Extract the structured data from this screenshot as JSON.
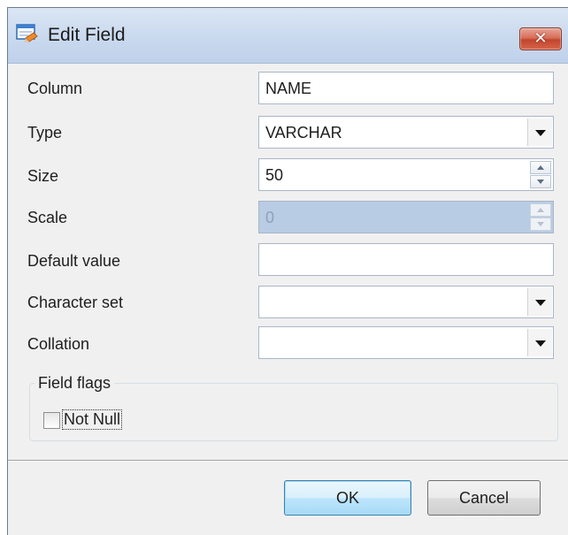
{
  "window": {
    "title": "Edit Field",
    "close_symbol": "✕"
  },
  "fields": [
    {
      "label": "Column",
      "value": "NAME",
      "kind": "text",
      "enabled": true
    },
    {
      "label": "Type",
      "value": "VARCHAR",
      "kind": "dropdown",
      "enabled": true
    },
    {
      "label": "Size",
      "value": "50",
      "kind": "spinner",
      "enabled": true
    },
    {
      "label": "Scale",
      "value": "0",
      "kind": "spinner",
      "enabled": false
    },
    {
      "label": "Default value",
      "value": "",
      "kind": "text",
      "enabled": true
    },
    {
      "label": "Character set",
      "value": "",
      "kind": "dropdown",
      "enabled": true
    },
    {
      "label": "Collation",
      "value": "",
      "kind": "dropdown",
      "enabled": true
    }
  ],
  "field_flags": {
    "legend": "Field flags",
    "not_null": {
      "label": "Not Null",
      "checked": false
    }
  },
  "buttons": {
    "ok": "OK",
    "cancel": "Cancel"
  },
  "icons": {
    "app": "edit-field-icon",
    "close": "close-icon",
    "dropdown": "chevron-down-icon",
    "spin_up": "spin-up-icon",
    "spin_down": "spin-down-icon"
  },
  "colors": {
    "titlebar": "#c9d9ee",
    "dialog_bg": "#f0f0f0",
    "disabled_field": "#b8cce4",
    "close_button": "#c2452c",
    "ok_button_border": "#3c7fb1"
  }
}
